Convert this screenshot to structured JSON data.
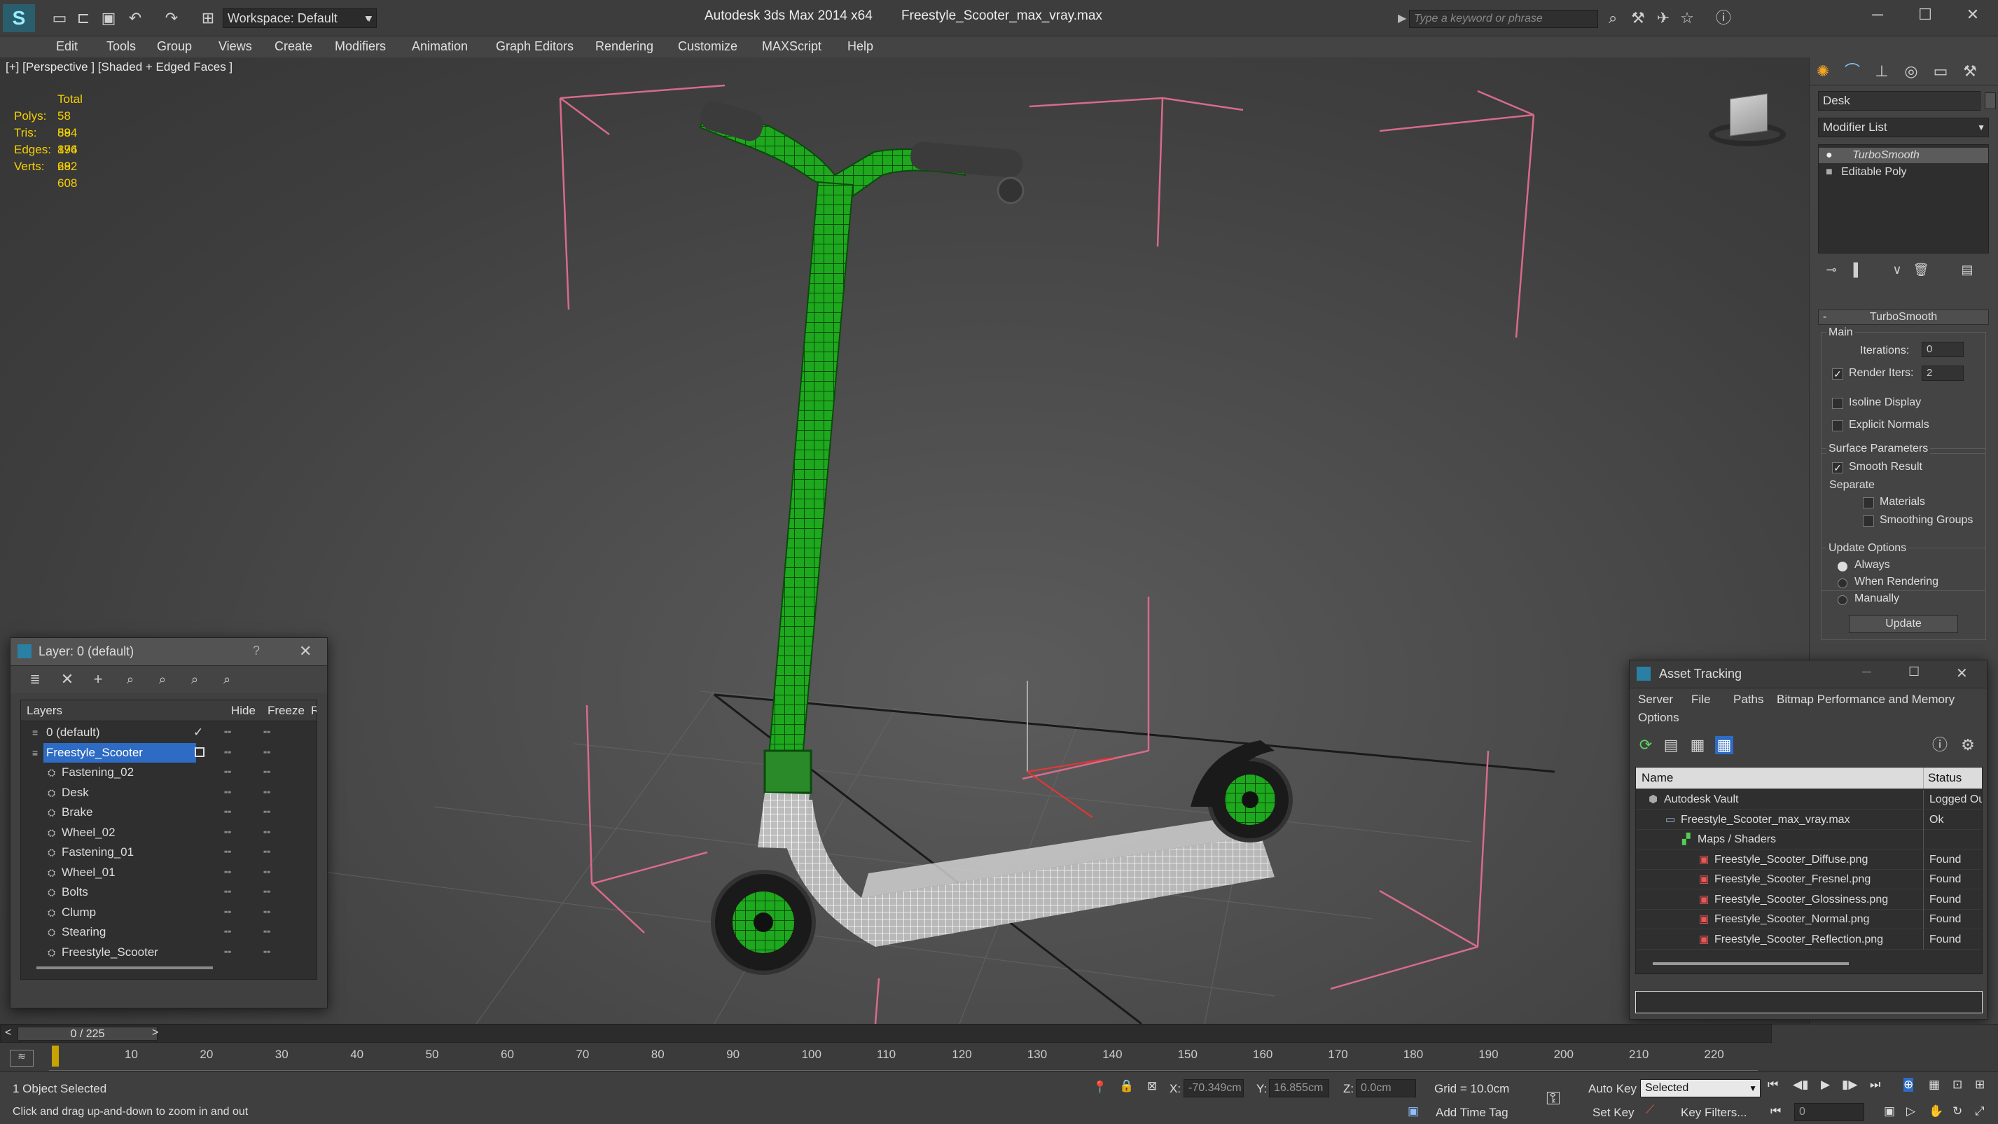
{
  "app": {
    "title": "Autodesk 3ds Max  2014 x64",
    "file": "Freestyle_Scooter_max_vray.max",
    "workspace": "Workspace: Default",
    "search_placeholder": "Type a keyword or phrase"
  },
  "menu": [
    "Edit",
    "Tools",
    "Group",
    "Views",
    "Create",
    "Modifiers",
    "Animation",
    "Graph Editors",
    "Rendering",
    "Customize",
    "MAXScript",
    "Help"
  ],
  "viewport": {
    "label": "[+] [Perspective ] [Shaded + Edged Faces ]",
    "stats": {
      "header": "Total",
      "rows": [
        {
          "label": "Polys:",
          "value": "58 894"
        },
        {
          "label": "Tris:",
          "value": "58 894"
        },
        {
          "label": "Edges:",
          "value": "176 682"
        },
        {
          "label": "Verts:",
          "value": "29 608"
        }
      ]
    }
  },
  "command_panel": {
    "object_name": "Desk",
    "modifier_list": "Modifier List",
    "stack": [
      "TurboSmooth",
      "Editable Poly"
    ],
    "rollout_title": "TurboSmooth",
    "main_label": "Main",
    "iterations_label": "Iterations:",
    "iterations_value": "0",
    "render_iters_label": "Render Iters:",
    "render_iters_value": "2",
    "isoline": "Isoline Display",
    "explicit_normals": "Explicit Normals",
    "surface_params": "Surface Parameters",
    "smooth_result": "Smooth Result",
    "separate": "Separate",
    "materials": "Materials",
    "smoothing_groups": "Smoothing Groups",
    "update_options": "Update Options",
    "always": "Always",
    "when_rendering": "When Rendering",
    "manually": "Manually",
    "update_button": "Update"
  },
  "layer_window": {
    "title": "Layer: 0 (default)",
    "help": "?",
    "columns": {
      "layers": "Layers",
      "hide": "Hide",
      "freeze": "Freeze",
      "render": "Re"
    },
    "rows": [
      {
        "name": "0 (default)",
        "indent": 1,
        "selected": false
      },
      {
        "name": "Freestyle_Scooter",
        "indent": 1,
        "selected": true
      },
      {
        "name": "Fastening_02",
        "indent": 2,
        "selected": false
      },
      {
        "name": "Desk",
        "indent": 2,
        "selected": false
      },
      {
        "name": "Brake",
        "indent": 2,
        "selected": false
      },
      {
        "name": "Wheel_02",
        "indent": 2,
        "selected": false
      },
      {
        "name": "Fastening_01",
        "indent": 2,
        "selected": false
      },
      {
        "name": "Wheel_01",
        "indent": 2,
        "selected": false
      },
      {
        "name": "Bolts",
        "indent": 2,
        "selected": false
      },
      {
        "name": "Clump",
        "indent": 2,
        "selected": false
      },
      {
        "name": "Stearing",
        "indent": 2,
        "selected": false
      },
      {
        "name": "Freestyle_Scooter",
        "indent": 2,
        "selected": false
      }
    ]
  },
  "asset_window": {
    "title": "Asset Tracking",
    "menu": [
      "Server",
      "File",
      "Paths",
      "Bitmap Performance and Memory"
    ],
    "menu2": "Options",
    "columns": {
      "name": "Name",
      "status": "Status"
    },
    "rows": [
      {
        "name": "Autodesk Vault",
        "status": "Logged Ou",
        "level": 1,
        "icon": "vault-icon"
      },
      {
        "name": "Freestyle_Scooter_max_vray.max",
        "status": "Ok",
        "level": 2,
        "icon": "max-file-icon"
      },
      {
        "name": "Maps / Shaders",
        "status": "",
        "level": 3,
        "icon": "maps-icon"
      },
      {
        "name": "Freestyle_Scooter_Diffuse.png",
        "status": "Found",
        "level": 4,
        "icon": "png-icon"
      },
      {
        "name": "Freestyle_Scooter_Fresnel.png",
        "status": "Found",
        "level": 4,
        "icon": "png-icon"
      },
      {
        "name": "Freestyle_Scooter_Glossiness.png",
        "status": "Found",
        "level": 4,
        "icon": "png-icon"
      },
      {
        "name": "Freestyle_Scooter_Normal.png",
        "status": "Found",
        "level": 4,
        "icon": "png-icon"
      },
      {
        "name": "Freestyle_Scooter_Reflection.png",
        "status": "Found",
        "level": 4,
        "icon": "png-icon"
      }
    ]
  },
  "timeline": {
    "frame": "0 / 225",
    "ticks": [
      "10",
      "20",
      "30",
      "40",
      "50",
      "60",
      "70",
      "80",
      "90",
      "100",
      "110",
      "120",
      "130",
      "140",
      "150",
      "160",
      "170",
      "180",
      "190",
      "200",
      "210",
      "220"
    ]
  },
  "status": {
    "selection": "1 Object Selected",
    "prompt": "Click and drag up-and-down to zoom in and out",
    "x_label": "X:",
    "x_value": "-70.349cm",
    "y_label": "Y:",
    "y_value": "16.855cm",
    "z_label": "Z:",
    "z_value": "0.0cm",
    "grid": "Grid = 10.0cm",
    "add_time_tag": "Add Time Tag",
    "auto_key": "Auto Key",
    "set_key": "Set Key",
    "selected": "Selected",
    "key_filters": "Key Filters...",
    "frame_field": "0"
  },
  "colors": {
    "accent_green": "#22cc22",
    "selection_blue": "#2d6bc4",
    "gizmo_pink": "#d86b8a"
  }
}
